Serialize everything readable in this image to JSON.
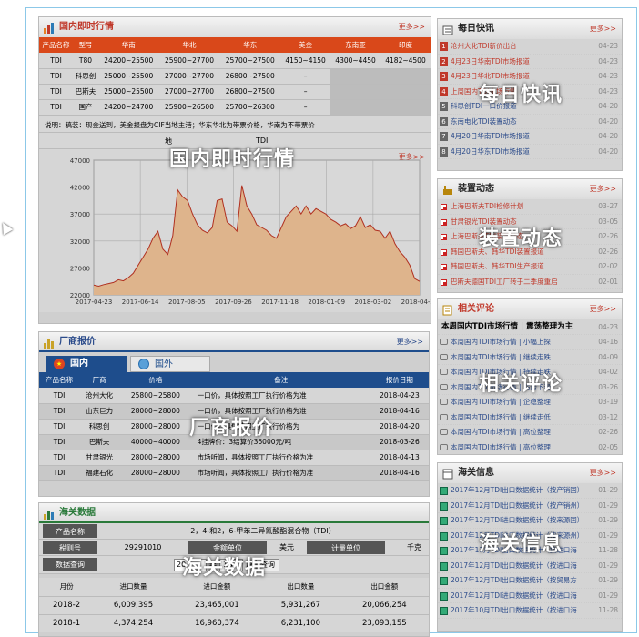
{
  "domestic": {
    "title": "国内即时行情",
    "more": "更多>>",
    "headers": [
      "产品名称",
      "型号",
      "华南",
      "华北",
      "华东",
      "美金",
      "东南亚",
      "印度"
    ],
    "rows": [
      [
        "TDI",
        "T80",
        "24200~25500",
        "25900~27700",
        "25700~27500",
        "4150~4150",
        "4300~4450",
        "4182~4500"
      ],
      [
        "TDI",
        "科思创",
        "25000~25500",
        "27000~27700",
        "26800~27500",
        "–",
        "",
        ""
      ],
      [
        "TDI",
        "巴斯夫",
        "25000~25500",
        "27000~27700",
        "26800~27500",
        "–",
        "",
        ""
      ],
      [
        "TDI",
        "国产",
        "24200~24700",
        "25900~26500",
        "25700~26300",
        "–",
        "",
        ""
      ]
    ],
    "note": "说明：稿装：现金送到，美金报盘为CIF当地主港；华东华北为带票价格，华南为不带票价",
    "chart_title_left": "地",
    "chart_title_right": "TDI",
    "overlay": "国内即时行情"
  },
  "chart_data": {
    "type": "area",
    "title": "",
    "x": [
      "2017-04-23",
      "2017-06-14",
      "2017-08-05",
      "2017-09-26",
      "2017-11-18",
      "2018-01-09",
      "2018-03-02",
      "2018-04-23"
    ],
    "yticks": [
      "22000",
      "27000",
      "32000",
      "37000",
      "42000",
      "47000"
    ],
    "ylim": [
      22000,
      47000
    ],
    "values": [
      23800,
      23600,
      23900,
      24100,
      24300,
      24800,
      24600,
      25200,
      26000,
      27500,
      29000,
      30500,
      32500,
      33800,
      30500,
      29500,
      33000,
      41500,
      40200,
      39500,
      37000,
      35000,
      34000,
      33500,
      34500,
      39500,
      39800,
      35500,
      34800,
      33800,
      42300,
      38500,
      37000,
      35000,
      34500,
      34000,
      33000,
      32500,
      34500,
      36500,
      37500,
      38500,
      37000,
      38500,
      37000,
      38000,
      37500,
      37000,
      36000,
      35500,
      34800,
      35200,
      34300,
      34800,
      36500,
      34500,
      35000,
      34000,
      33800,
      32500,
      33800,
      31500,
      30000,
      29000,
      27500,
      25000,
      24500
    ],
    "color": "#deb48c"
  },
  "factory": {
    "title": "厂商报价",
    "more": "更多>>",
    "tab_domestic": "国内",
    "tab_foreign": "国外",
    "headers": [
      "产品名称",
      "厂商",
      "价格",
      "备注",
      "报价日期"
    ],
    "rows": [
      [
        "TDI",
        "沧州大化",
        "25800~25800",
        "一口价，具体按照工厂执行价格为准",
        "2018-04-23"
      ],
      [
        "TDI",
        "山东巨力",
        "28000~28000",
        "一口价，具体按照工厂执行价格为准",
        "2018-04-16"
      ],
      [
        "TDI",
        "科思创",
        "28000~28000",
        "一口价，具体按照工厂执行价格为",
        "2018-04-20"
      ],
      [
        "TDI",
        "巴斯夫",
        "40000~40000",
        "4挂牌价：3结算价36000元/吨",
        "2018-03-26"
      ],
      [
        "TDI",
        "甘肃银光",
        "28000~28000",
        "市场听闻，具体按照工厂执行价格为准",
        "2018-04-13"
      ],
      [
        "TDI",
        "福建石化",
        "28000~28000",
        "市场听闻，具体按照工厂执行价格为准",
        "2018-04-16"
      ]
    ],
    "overlay": "厂商报价"
  },
  "customs": {
    "title": "海关数据",
    "product_label": "产品名称",
    "product_value": "2，4-和2，6-甲苯二异氰酸酯混合物（TDI）",
    "tax_label": "税则号",
    "tax_value": "29291010",
    "unit_label": "金额单位",
    "unit_value": "美元",
    "measure_label": "计量单位",
    "measure_value": "千克",
    "query_label": "数据查询",
    "year_value": "20",
    "year_suffix": "年",
    "month_value": "1",
    "month_suffix": "月",
    "query_button": "查询",
    "headers": [
      "月份",
      "进口数量",
      "进口金额",
      "出口数量",
      "出口金额"
    ],
    "rows": [
      [
        "2018-2",
        "6,009,395",
        "23,465,001",
        "5,931,267",
        "20,066,254"
      ],
      [
        "2018-1",
        "4,374,254",
        "16,960,374",
        "6,231,100",
        "23,093,155"
      ]
    ],
    "overlay": "海关数据"
  },
  "daily": {
    "title": "每日快讯",
    "more": "更多>>",
    "overlay": "每日快讯",
    "items": [
      {
        "n": "1",
        "t": "沧州大化TDI新价出台",
        "d": "04-23"
      },
      {
        "n": "2",
        "t": "4月23日华南TDI市场报道",
        "d": "04-23"
      },
      {
        "n": "3",
        "t": "4月23日华北TDI市场报道",
        "d": "04-23"
      },
      {
        "n": "4",
        "t": "上周国内TDI市场行情",
        "d": "04-23"
      },
      {
        "n": "5",
        "t": "科思创TDI一口价报道",
        "d": "04-20"
      },
      {
        "n": "6",
        "t": "东南电化TDI装置动态",
        "d": "04-20"
      },
      {
        "n": "7",
        "t": "4月20日华南TDI市场报道",
        "d": "04-20"
      },
      {
        "n": "8",
        "t": "4月20日华东TDI市场报道",
        "d": "04-20"
      }
    ]
  },
  "device": {
    "title": "装置动态",
    "more": "更多>>",
    "overlay": "装置动态",
    "items": [
      {
        "t": "上海巴斯夫TDI检修计划",
        "d": "03-27"
      },
      {
        "t": "甘肃银光TDI装置动态",
        "d": "03-05"
      },
      {
        "t": "上海巴斯夫TDI装置动态",
        "d": "02-26"
      },
      {
        "t": "韩国巴斯夫、韩华TDI装置报道",
        "d": "02-26"
      },
      {
        "t": "韩国巴斯夫、韩华TDI生产报道",
        "d": "02-02"
      },
      {
        "t": "巴斯夫德国TDI工厂转于二季度重启",
        "d": "02-01"
      }
    ]
  },
  "comments": {
    "title": "相关评论",
    "more": "更多>>",
    "overlay": "相关评论",
    "lead": {
      "t": "本周国内TDI市场行情",
      "s": "震荡整理为主",
      "d": "04-23"
    },
    "items": [
      {
        "t": "本周国内TDI市场行情",
        "s": "小幅上探",
        "d": "04-16"
      },
      {
        "t": "本周国内TDI市场行情",
        "s": "继续走跌",
        "d": "04-09"
      },
      {
        "t": "本周国内TDI市场行情",
        "s": "持续走跌",
        "d": "04-02"
      },
      {
        "t": "本周国内TDI市场行情",
        "s": "弱势下滑",
        "d": "03-26"
      },
      {
        "t": "本周国内TDI市场行情",
        "s": "企稳整理",
        "d": "03-19"
      },
      {
        "t": "本周国内TDI市场行情",
        "s": "继续走低",
        "d": "03-12"
      },
      {
        "t": "本周国内TDI市场行情",
        "s": "高位整理",
        "d": "02-26"
      },
      {
        "t": "本周国内TDI市场行情",
        "s": "高位整理",
        "d": "02-05"
      }
    ]
  },
  "customs_info": {
    "title": "海关信息",
    "more": "更多>>",
    "overlay": "海关信息",
    "items": [
      {
        "t": "2017年12月TDI出口数据统计（按产销国）",
        "d": "01-29"
      },
      {
        "t": "2017年12月TDI出口数据统计（按产销州）",
        "d": "01-29"
      },
      {
        "t": "2017年12月TDI进口数据统计（按来源国）",
        "d": "01-29"
      },
      {
        "t": "2017年12月TDI进口数据统计（按来源州）",
        "d": "01-29"
      },
      {
        "t": "2017年11月TDI出口数据统计（按进口海",
        "d": "11-28"
      },
      {
        "t": "2017年12月TDI出口数据统计（按进口海",
        "d": "01-29"
      },
      {
        "t": "2017年12月TDI出口数据统计（按贸易方",
        "d": "01-29"
      },
      {
        "t": "2017年12月TDI进口数据统计（按进口海",
        "d": "01-29"
      },
      {
        "t": "2017年10月TDI出口数据统计（按进口海",
        "d": "11-28"
      }
    ]
  }
}
